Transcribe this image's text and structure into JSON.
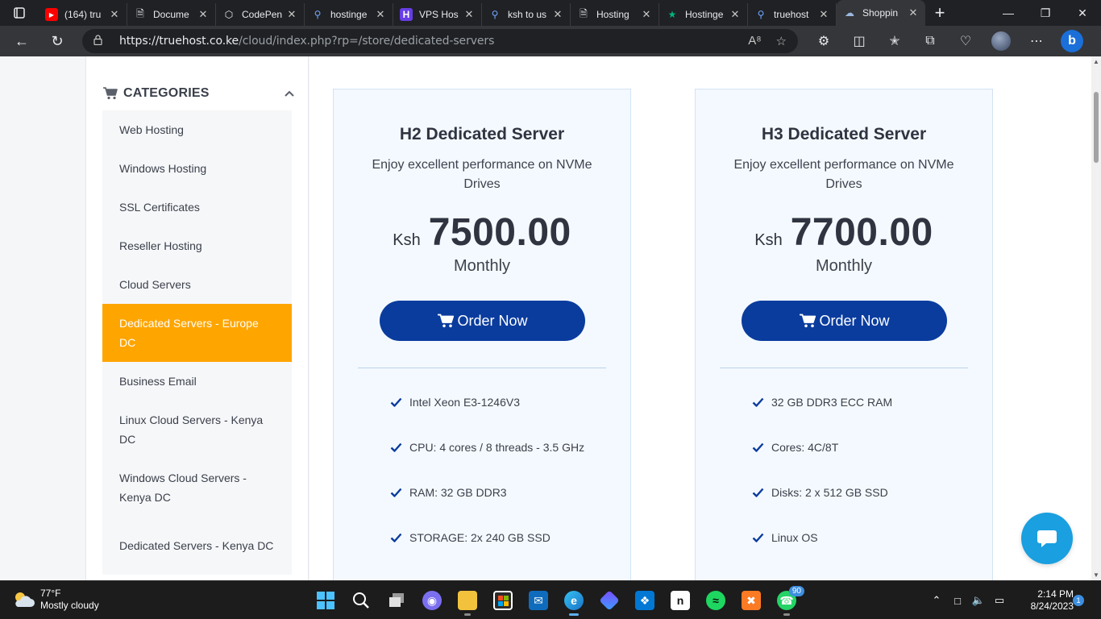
{
  "browser": {
    "tabs": [
      {
        "title": "(164) tru",
        "icon": "youtube-icon",
        "color": "#ff0000"
      },
      {
        "title": "Docume",
        "icon": "document-icon",
        "color": "#e8eaed"
      },
      {
        "title": "CodePen",
        "icon": "codepen-icon",
        "color": "#e8eaed"
      },
      {
        "title": "hostinge",
        "icon": "search-icon",
        "color": "#6ea6ff"
      },
      {
        "title": "VPS Hos",
        "icon": "hostinger-icon",
        "color": "#673de6"
      },
      {
        "title": "ksh to us",
        "icon": "search-icon",
        "color": "#6ea6ff"
      },
      {
        "title": "Hosting",
        "icon": "document-icon",
        "color": "#e8eaed"
      },
      {
        "title": "Hostinge",
        "icon": "star-icon",
        "color": "#00b67a"
      },
      {
        "title": "truehost",
        "icon": "search-icon",
        "color": "#6ea6ff"
      },
      {
        "title": "Shoppin",
        "icon": "cloud-icon",
        "color": "#9ab8e0",
        "active": true
      }
    ],
    "url_host": "https://truehost.co.ke",
    "url_path": "/cloud/index.php?rp=/store/dedicated-servers"
  },
  "sidebar": {
    "heading": "CATEGORIES",
    "items": [
      {
        "label": "Web Hosting",
        "lines": 1
      },
      {
        "label": "Windows Hosting",
        "lines": 1
      },
      {
        "label": "SSL Certificates",
        "lines": 1
      },
      {
        "label": "Reseller Hosting",
        "lines": 1
      },
      {
        "label": "Cloud Servers",
        "lines": 1
      },
      {
        "label": "Dedicated Servers - Europe DC",
        "lines": 2,
        "active": true
      },
      {
        "label": "Business Email",
        "lines": 1
      },
      {
        "label": "Linux Cloud Servers - Kenya DC",
        "lines": 2
      },
      {
        "label": "Windows Cloud Servers - Kenya DC",
        "lines": 2
      },
      {
        "label": "Dedicated Servers - Kenya DC",
        "lines": 2
      }
    ]
  },
  "products": [
    {
      "title": "H2 Dedicated Server",
      "description": "Enjoy excellent performance on NVMe Drives",
      "currency": "Ksh",
      "price": "7500.00",
      "period": "Monthly",
      "button": "Order Now",
      "features": [
        "Intel Xeon E3-1246V3",
        "CPU: 4 cores / 8 threads - 3.5 GHz",
        "RAM: 32 GB DDR3",
        "STORAGE: 2x 240 GB SSD"
      ]
    },
    {
      "title": "H3 Dedicated Server",
      "description": "Enjoy excellent performance on NVMe Drives",
      "currency": "Ksh",
      "price": "7700.00",
      "period": "Monthly",
      "button": "Order Now",
      "features": [
        "32 GB DDR3 ECC RAM",
        "Cores: 4C/8T",
        "Disks: 2 x 512 GB SSD",
        "Linux OS"
      ]
    }
  ],
  "taskbar": {
    "temperature": "77°F",
    "weather": "Mostly cloudy",
    "time": "2:14 PM",
    "date": "8/24/2023",
    "whatsapp_badge": "90",
    "notification_count": "1"
  },
  "colors": {
    "accent_orange": "#ffa500",
    "button_blue": "#0a3c9e",
    "chat_blue": "#1a9fe0"
  }
}
